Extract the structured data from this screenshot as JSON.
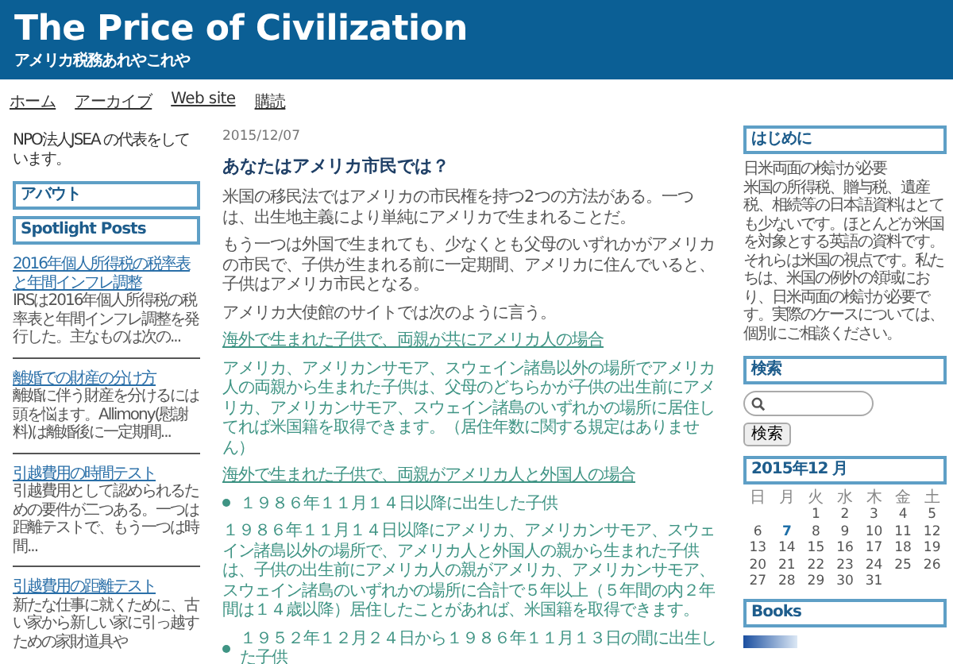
{
  "header": {
    "title": "The Price of Civilization",
    "subtitle": "アメリカ税務あれやこれや"
  },
  "nav": [
    "ホーム",
    "アーカイブ",
    "Web site",
    "購読"
  ],
  "left": {
    "intro": "NPO法人JSEA の代表をしています。",
    "boxes": [
      "アバウト",
      "Spotlight Posts"
    ],
    "posts": [
      {
        "title": "2016年個人所得税の税率表と年間インフレ調整",
        "excerpt": "IRSは2016年個人所得税の税率表と年間インフレ調整を発行した。主なものは次の..."
      },
      {
        "title": "離婚での財産の分け方",
        "excerpt": "離婚に伴う財産を分けるには頭を悩ます。Allimony(慰謝料)は離婚後に一定期間..."
      },
      {
        "title": "引越費用の時間テスト",
        "excerpt": "引越費用として認められるための要件が二つある。一つは距離テストで、もう一つは時間..."
      },
      {
        "title": "引越費用の距離テスト",
        "excerpt": "新たな仕事に就くために、古い家から新しい家に引っ越すための家財道具や"
      }
    ]
  },
  "main": {
    "date": "2015/12/07",
    "title": "あなたはアメリカ市民では？",
    "blocks": [
      {
        "kind": "para",
        "text": "米国の移民法ではアメリカの市民権を持つ2つの方法がある。一つは、出生地主義により単純にアメリカで生まれることだ。"
      },
      {
        "kind": "para",
        "text": "もう一つは外国で生まれても、少なくとも父母のいずれかがアメリカの市民で、子供が生まれる前に一定期間、アメリカに住んでいると、子供はアメリカ市民となる。"
      },
      {
        "kind": "para",
        "text": "アメリカ大使館のサイトでは次のように言う。"
      },
      {
        "kind": "link",
        "text": "海外で生まれた子供で、両親が共にアメリカ人の場合"
      },
      {
        "kind": "quote",
        "text": "アメリカ、アメリカンサモア、スウェイン諸島以外の場所でアメリカ人の両親から生まれた子供は、父母のどちらかが子供の出生前にアメリカ、アメリカンサモア、スウェイン諸島のいずれかの場所に居住してれば米国籍を取得できます。（居住年数に関する規定はありません）"
      },
      {
        "kind": "link",
        "text": "海外で生まれた子供で、両親がアメリカ人と外国人の場合"
      },
      {
        "kind": "bullet",
        "text": "１９８６年１１月１４日以降に出生した子供"
      },
      {
        "kind": "quote",
        "text": "１９８６年１１月１４日以降にアメリカ、アメリカンサモア、スウェイン諸島以外の場所で、アメリカ人と外国人の親から生まれた子供は、子供の出生前にアメリカ人の親がアメリカ、アメリカンサモア、スウェイン諸島のいずれかの場所に合計で５年以上（５年間の内２年間は１４歳以降）居住したことがあれば、米国籍を取得できます。"
      },
      {
        "kind": "bullet",
        "text": "１９５２年１２月２４日から１９８６年１１月１３日の間に出生した子供"
      }
    ]
  },
  "right": {
    "intro_title": "はじめに",
    "intro_heading": "日米両面の検討が必要",
    "intro_text": "米国の所得税、贈与税、遺産税、相続等の日本語資料はとても少ないです。ほとんどが米国を対象とする英語の資料です。それらは米国の視点です。私たちは、米国の例外の領域におり、日米両面の検討が必要です。実際のケースについては、個別にご相談ください。",
    "search_title": "検索",
    "search_button": "検索",
    "calendar": {
      "title": "2015年12 月",
      "weekdays": [
        "日",
        "月",
        "火",
        "水",
        "木",
        "金",
        "土"
      ],
      "weeks": [
        [
          {
            "day": "1",
            "selected": false
          },
          {
            "day": "2",
            "selected": false
          },
          {
            "day": "3",
            "selected": false
          },
          {
            "day": "4",
            "selected": false
          },
          {
            "day": "5",
            "selected": false
          }
        ],
        [
          {
            "day": "6",
            "selected": false
          },
          {
            "day": "7",
            "selected": true
          },
          {
            "day": "8",
            "selected": false
          },
          {
            "day": "9",
            "selected": false
          },
          {
            "day": "10",
            "selected": false
          },
          {
            "day": "11",
            "selected": false
          },
          {
            "day": "12",
            "selected": false
          }
        ],
        [
          {
            "day": "13",
            "selected": false
          },
          {
            "day": "14",
            "selected": false
          },
          {
            "day": "15",
            "selected": false
          },
          {
            "day": "16",
            "selected": false
          },
          {
            "day": "17",
            "selected": false
          },
          {
            "day": "18",
            "selected": false
          },
          {
            "day": "19",
            "selected": false
          }
        ],
        [
          {
            "day": "20",
            "selected": false
          },
          {
            "day": "21",
            "selected": false
          },
          {
            "day": "22",
            "selected": false
          },
          {
            "day": "23",
            "selected": false
          },
          {
            "day": "24",
            "selected": false
          },
          {
            "day": "25",
            "selected": false
          },
          {
            "day": "26",
            "selected": false
          }
        ],
        [
          {
            "day": "27",
            "selected": false
          },
          {
            "day": "28",
            "selected": false
          },
          {
            "day": "29",
            "selected": false
          },
          {
            "day": "30",
            "selected": false
          },
          {
            "day": "31",
            "selected": false
          }
        ]
      ]
    },
    "books_title": "Books"
  }
}
